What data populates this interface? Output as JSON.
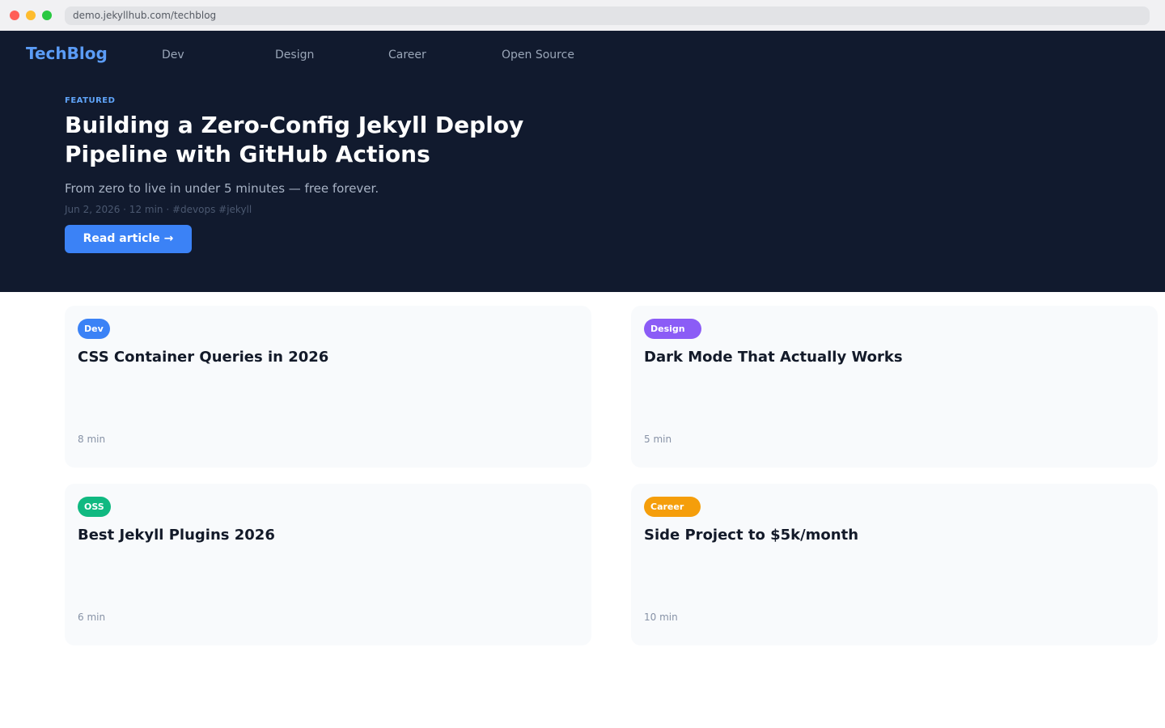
{
  "browser": {
    "url": "demo.jekyllhub.com/techblog"
  },
  "nav": {
    "logo": "TechBlog",
    "links": [
      "Dev",
      "Design",
      "Career",
      "Open Source"
    ]
  },
  "featured": {
    "tag": "FEATURED",
    "title": "Building a Zero-Config Jekyll Deploy Pipeline with GitHub Actions",
    "subtitle": "From zero to live in under 5 minutes — free forever.",
    "meta": "Jun 2, 2026 · 12 min · #devops #jekyll",
    "button": "Read article →"
  },
  "cards": [
    {
      "badge": "Dev",
      "badge_color": "#3b82f6",
      "title": "CSS Container Queries in 2026",
      "read_time": "8 min"
    },
    {
      "badge": "Design",
      "badge_color": "#8b5cf6",
      "title": "Dark Mode That Actually Works",
      "read_time": "5 min"
    },
    {
      "badge": "OSS",
      "badge_color": "#10b981",
      "title": "Best Jekyll Plugins 2026",
      "read_time": "6 min"
    },
    {
      "badge": "Career",
      "badge_color": "#f59e0b",
      "title": "Side Project to $5k/month",
      "read_time": "10 min"
    }
  ],
  "colors": {
    "hero_bg": "#111a2e",
    "accent": "#3b82f6",
    "logo": "#5b9cf6"
  }
}
